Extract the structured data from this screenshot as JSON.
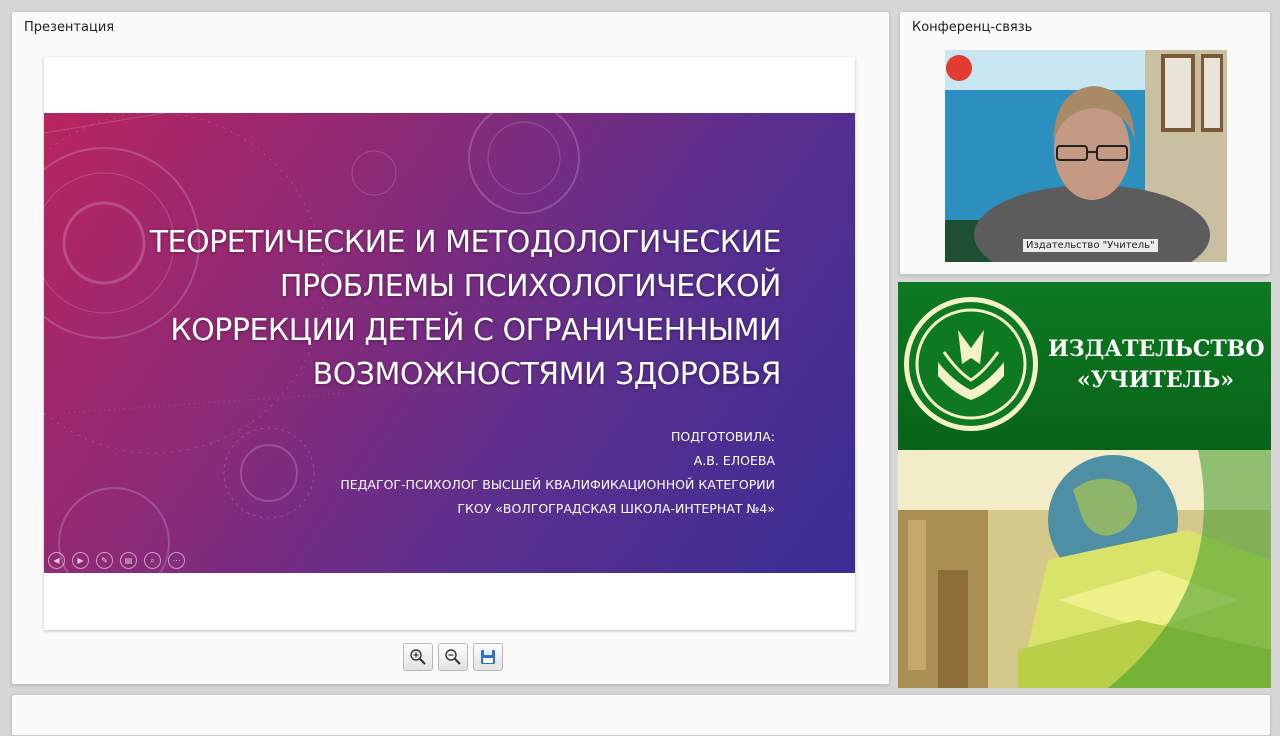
{
  "presentation": {
    "panel_title": "Презентация",
    "slide": {
      "title_lines": [
        "ТЕОРЕТИЧЕСКИЕ И МЕТОДОЛОГИЧЕСКИЕ",
        "ПРОБЛЕМЫ ПСИХОЛОГИЧЕСКОЙ",
        "КОРРЕКЦИИ ДЕТЕЙ С ОГРАНИЧЕННЫМИ",
        "ВОЗМОЖНОСТЯМИ ЗДОРОВЬЯ"
      ],
      "subtitle_lines": [
        "ПОДГОТОВИЛА:",
        "А.В. ЕЛОЕВА",
        "ПЕДАГОГ-ПСИХОЛОГ ВЫСШЕЙ КВАЛИФИКАЦИОННОЙ КАТЕГОРИИ",
        "ГКОУ «ВОЛГОГРАДСКАЯ ШКОЛА-ИНТЕРНАТ №4»"
      ],
      "gradient_colors": [
        "#b8245f",
        "#5a2f8f",
        "#3a2d93"
      ]
    },
    "slide_controls": [
      "previous-icon",
      "next-icon",
      "pen-icon",
      "slides-icon",
      "zoom-icon",
      "more-icon"
    ],
    "toolbar": [
      "zoom-in-icon",
      "zoom-out-icon",
      "save-icon"
    ]
  },
  "conference": {
    "panel_title": "Конференц-связь",
    "speaker_label": "Издательство \"Учитель\""
  },
  "brand": {
    "line1": "ИЗДАТЕЛЬСТВО",
    "line2": "«УЧИТЕЛЬ»",
    "color": "#0d7a22"
  }
}
